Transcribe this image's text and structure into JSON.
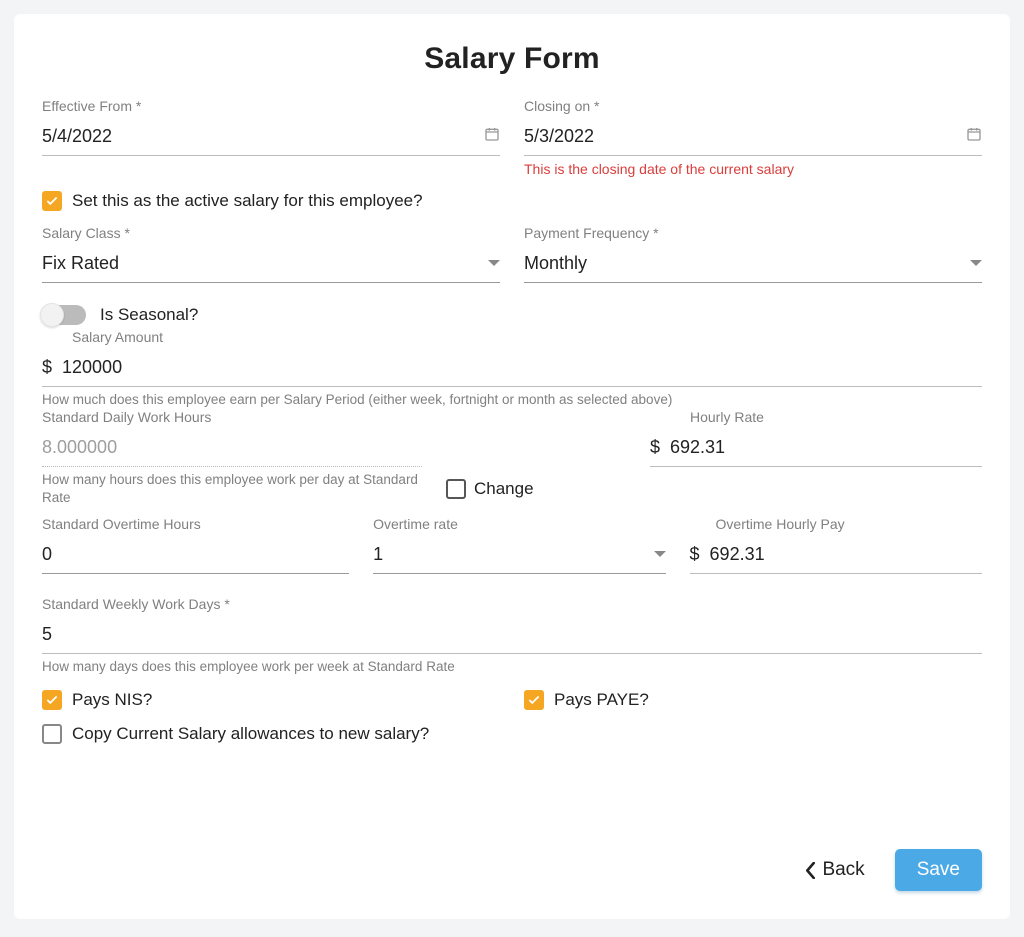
{
  "title": "Salary Form",
  "effective_from": {
    "label": "Effective From *",
    "value": "5/4/2022"
  },
  "closing_on": {
    "label": "Closing on *",
    "value": "5/3/2022",
    "help": "This is the closing date of the current salary"
  },
  "active_salary": {
    "checked": true,
    "label": "Set this as the active salary for this employee?"
  },
  "salary_class": {
    "label": "Salary Class *",
    "value": "Fix Rated"
  },
  "payment_frequency": {
    "label": "Payment Frequency *",
    "value": "Monthly"
  },
  "is_seasonal": {
    "label": "Is Seasonal?"
  },
  "salary_amount": {
    "label": "Salary Amount",
    "currency": "$",
    "value": "120000",
    "help": "How much does this employee earn per Salary Period (either week, fortnight or month as selected above)"
  },
  "std_daily_hours": {
    "label": "Standard Daily Work Hours",
    "value": "8.000000",
    "help": "How many hours does this employee work per day at Standard Rate"
  },
  "change": {
    "label": "Change"
  },
  "hourly_rate": {
    "label": "Hourly Rate",
    "currency": "$",
    "value": "692.31"
  },
  "std_overtime_hours": {
    "label": "Standard Overtime Hours",
    "value": "0"
  },
  "overtime_rate": {
    "label": "Overtime rate",
    "value": "1"
  },
  "overtime_hourly_pay": {
    "label": "Overtime Hourly Pay",
    "currency": "$",
    "value": "692.31"
  },
  "std_weekly_days": {
    "label": "Standard Weekly Work Days *",
    "value": "5",
    "help": "How many days does this employee work per week at Standard Rate"
  },
  "pays_nis": {
    "checked": true,
    "label": "Pays NIS?"
  },
  "pays_paye": {
    "checked": true,
    "label": "Pays PAYE?"
  },
  "copy_allowances": {
    "checked": false,
    "label": "Copy Current Salary allowances to new salary?"
  },
  "buttons": {
    "back": "Back",
    "save": "Save"
  }
}
